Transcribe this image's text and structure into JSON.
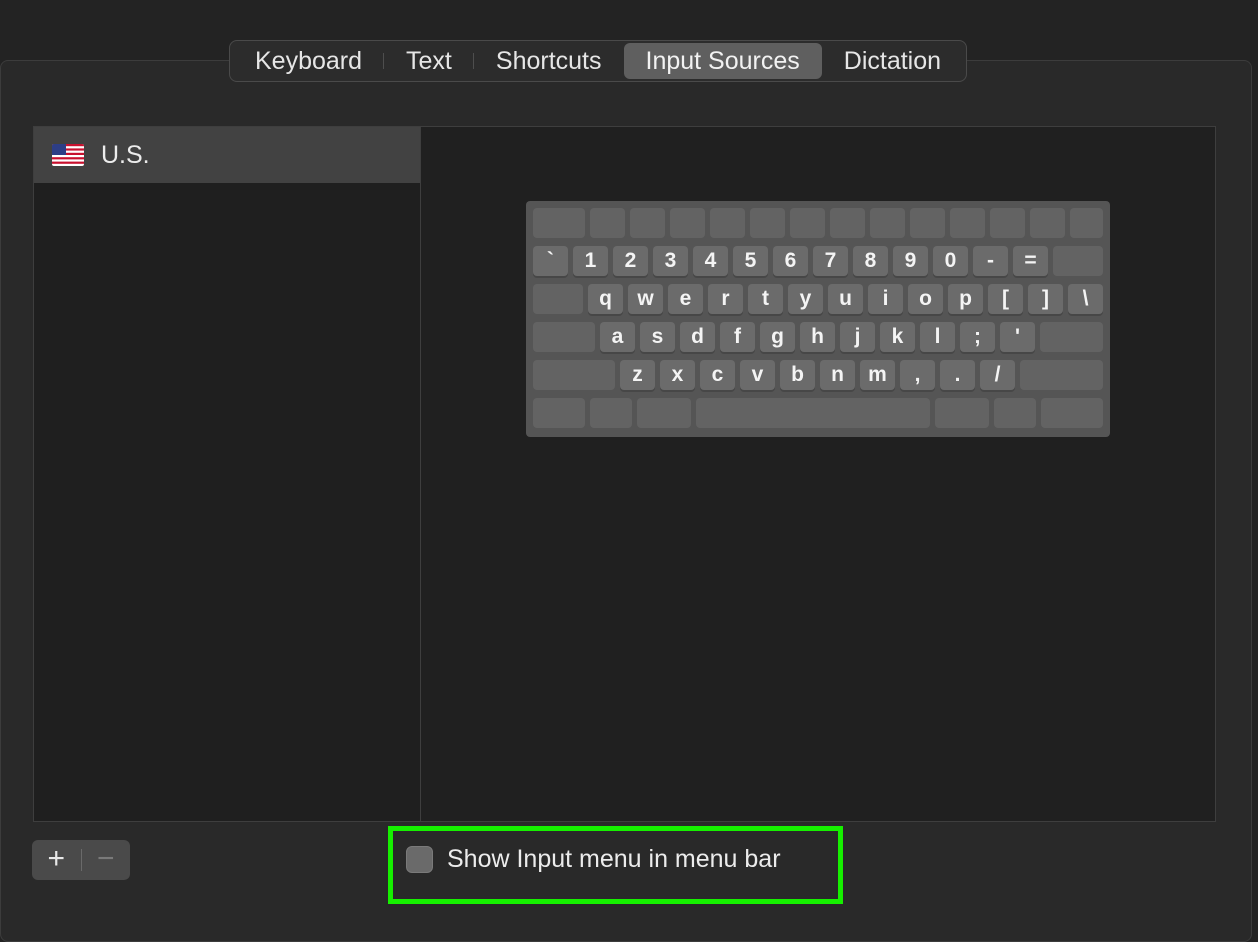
{
  "tabs": [
    {
      "label": "Keyboard",
      "active": false
    },
    {
      "label": "Text",
      "active": false
    },
    {
      "label": "Shortcuts",
      "active": false
    },
    {
      "label": "Input Sources",
      "active": true
    },
    {
      "label": "Dictation",
      "active": false
    }
  ],
  "input_sources": {
    "items": [
      {
        "label": "U.S.",
        "icon": "us-flag-icon",
        "selected": true
      }
    ]
  },
  "keyboard_preview": {
    "rows": [
      [
        "",
        "",
        "",
        "",
        "",
        "",
        "",
        "",
        "",
        "",
        "",
        "",
        "",
        ""
      ],
      [
        "`",
        "1",
        "2",
        "3",
        "4",
        "5",
        "6",
        "7",
        "8",
        "9",
        "0",
        "-",
        "=",
        ""
      ],
      [
        "",
        "q",
        "w",
        "e",
        "r",
        "t",
        "y",
        "u",
        "i",
        "o",
        "p",
        "[",
        "]",
        "\\"
      ],
      [
        "",
        "a",
        "s",
        "d",
        "f",
        "g",
        "h",
        "j",
        "k",
        "l",
        ";",
        "'",
        ""
      ],
      [
        "",
        "z",
        "x",
        "c",
        "v",
        "b",
        "n",
        "m",
        ",",
        ".",
        "/",
        ""
      ],
      [
        "",
        "",
        "",
        "",
        "",
        "",
        ""
      ]
    ]
  },
  "buttons": {
    "add": "+",
    "remove": "−"
  },
  "show_input_menu": {
    "label": "Show Input menu in menu bar",
    "checked": false
  },
  "colors": {
    "highlight": "#16f000",
    "active_tab": "#5f5f5f"
  }
}
